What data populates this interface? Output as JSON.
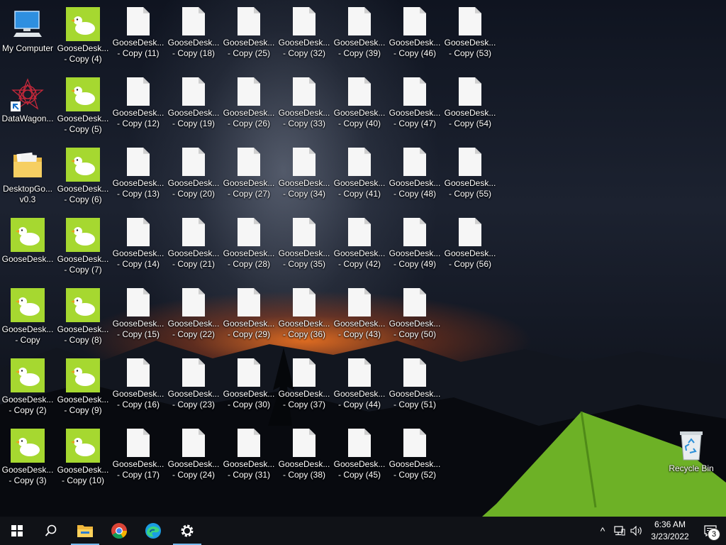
{
  "desktop": {
    "system_icons": [
      {
        "label": "My Computer",
        "icon": "computer-icon",
        "col": 0,
        "row": 0
      },
      {
        "label": "DataWagon...",
        "icon": "datawagon-shortcut-icon",
        "col": 0,
        "row": 1
      },
      {
        "label": "DesktopGo...\nv0.3",
        "icon": "folder-icon",
        "col": 0,
        "row": 2
      }
    ],
    "recycle_bin": {
      "label": "Recycle Bin",
      "icon": "recycle-bin-icon"
    },
    "goose_icons": [
      {
        "label": "GooseDesk...",
        "col": 0,
        "row": 3
      },
      {
        "label": "GooseDesk...\n- Copy",
        "col": 0,
        "row": 4
      },
      {
        "label": "GooseDesk...\n- Copy (2)",
        "col": 0,
        "row": 5
      },
      {
        "label": "GooseDesk...\n- Copy (3)",
        "col": 0,
        "row": 6
      },
      {
        "label": "GooseDesk...\n- Copy (4)",
        "col": 1,
        "row": 0
      },
      {
        "label": "GooseDesk...\n- Copy (5)",
        "col": 1,
        "row": 1
      },
      {
        "label": "GooseDesk...\n- Copy (6)",
        "col": 1,
        "row": 2
      },
      {
        "label": "GooseDesk...\n- Copy (7)",
        "col": 1,
        "row": 3
      },
      {
        "label": "GooseDesk...\n- Copy (8)",
        "col": 1,
        "row": 4
      },
      {
        "label": "GooseDesk...\n- Copy (9)",
        "col": 1,
        "row": 5
      },
      {
        "label": "GooseDesk...\n- Copy (10)",
        "col": 1,
        "row": 6
      }
    ],
    "file_icons": [
      {
        "label": "GooseDesk...\n- Copy (11)",
        "col": 2,
        "row": 0
      },
      {
        "label": "GooseDesk...\n- Copy (12)",
        "col": 2,
        "row": 1
      },
      {
        "label": "GooseDesk...\n- Copy (13)",
        "col": 2,
        "row": 2
      },
      {
        "label": "GooseDesk...\n- Copy (14)",
        "col": 2,
        "row": 3
      },
      {
        "label": "GooseDesk...\n- Copy (15)",
        "col": 2,
        "row": 4
      },
      {
        "label": "GooseDesk...\n- Copy (16)",
        "col": 2,
        "row": 5
      },
      {
        "label": "GooseDesk...\n- Copy (17)",
        "col": 2,
        "row": 6
      },
      {
        "label": "GooseDesk...\n- Copy (18)",
        "col": 3,
        "row": 0
      },
      {
        "label": "GooseDesk...\n- Copy (19)",
        "col": 3,
        "row": 1
      },
      {
        "label": "GooseDesk...\n- Copy (20)",
        "col": 3,
        "row": 2
      },
      {
        "label": "GooseDesk...\n- Copy (21)",
        "col": 3,
        "row": 3
      },
      {
        "label": "GooseDesk...\n- Copy (22)",
        "col": 3,
        "row": 4
      },
      {
        "label": "GooseDesk...\n- Copy (23)",
        "col": 3,
        "row": 5
      },
      {
        "label": "GooseDesk...\n- Copy (24)",
        "col": 3,
        "row": 6
      },
      {
        "label": "GooseDesk...\n- Copy (25)",
        "col": 4,
        "row": 0
      },
      {
        "label": "GooseDesk...\n- Copy (26)",
        "col": 4,
        "row": 1
      },
      {
        "label": "GooseDesk...\n- Copy (27)",
        "col": 4,
        "row": 2
      },
      {
        "label": "GooseDesk...\n- Copy (28)",
        "col": 4,
        "row": 3
      },
      {
        "label": "GooseDesk...\n- Copy (29)",
        "col": 4,
        "row": 4
      },
      {
        "label": "GooseDesk...\n- Copy (30)",
        "col": 4,
        "row": 5
      },
      {
        "label": "GooseDesk...\n- Copy (31)",
        "col": 4,
        "row": 6
      },
      {
        "label": "GooseDesk...\n- Copy (32)",
        "col": 5,
        "row": 0
      },
      {
        "label": "GooseDesk...\n- Copy (33)",
        "col": 5,
        "row": 1
      },
      {
        "label": "GooseDesk...\n- Copy (34)",
        "col": 5,
        "row": 2
      },
      {
        "label": "GooseDesk...\n- Copy (35)",
        "col": 5,
        "row": 3
      },
      {
        "label": "GooseDesk...\n- Copy (36)",
        "col": 5,
        "row": 4
      },
      {
        "label": "GooseDesk...\n- Copy (37)",
        "col": 5,
        "row": 5
      },
      {
        "label": "GooseDesk...\n- Copy (38)",
        "col": 5,
        "row": 6
      },
      {
        "label": "GooseDesk...\n- Copy (39)",
        "col": 6,
        "row": 0
      },
      {
        "label": "GooseDesk...\n- Copy (40)",
        "col": 6,
        "row": 1
      },
      {
        "label": "GooseDesk...\n- Copy (41)",
        "col": 6,
        "row": 2
      },
      {
        "label": "GooseDesk...\n- Copy (42)",
        "col": 6,
        "row": 3
      },
      {
        "label": "GooseDesk...\n- Copy (43)",
        "col": 6,
        "row": 4
      },
      {
        "label": "GooseDesk...\n- Copy (44)",
        "col": 6,
        "row": 5
      },
      {
        "label": "GooseDesk...\n- Copy (45)",
        "col": 6,
        "row": 6
      },
      {
        "label": "GooseDesk...\n- Copy (46)",
        "col": 7,
        "row": 0
      },
      {
        "label": "GooseDesk...\n- Copy (47)",
        "col": 7,
        "row": 1
      },
      {
        "label": "GooseDesk...\n- Copy (48)",
        "col": 7,
        "row": 2
      },
      {
        "label": "GooseDesk...\n- Copy (49)",
        "col": 7,
        "row": 3
      },
      {
        "label": "GooseDesk...\n- Copy (50)",
        "col": 7,
        "row": 4
      },
      {
        "label": "GooseDesk...\n- Copy (51)",
        "col": 7,
        "row": 5
      },
      {
        "label": "GooseDesk...\n- Copy (52)",
        "col": 7,
        "row": 6
      },
      {
        "label": "GooseDesk...\n- Copy (53)",
        "col": 8,
        "row": 0
      },
      {
        "label": "GooseDesk...\n- Copy (54)",
        "col": 8,
        "row": 1
      },
      {
        "label": "GooseDesk...\n- Copy (55)",
        "col": 8,
        "row": 2
      },
      {
        "label": "GooseDesk...\n- Copy (56)",
        "col": 8,
        "row": 3
      }
    ]
  },
  "taskbar": {
    "start_icon": "windows-start-icon",
    "search_icon": "search-icon",
    "pinned": [
      {
        "icon": "file-explorer-icon",
        "active": true
      },
      {
        "icon": "chrome-icon",
        "active": false
      },
      {
        "icon": "edge-icon",
        "active": false
      },
      {
        "icon": "settings-gear-icon",
        "active": true
      }
    ],
    "tray": {
      "chevron": "^",
      "time": "6:36 AM",
      "date": "3/23/2022",
      "notification_count": "3"
    }
  },
  "colors": {
    "goose_green": "#a6d830",
    "taskbar_bg": "#101217",
    "active_indicator": "#76b9ed"
  }
}
